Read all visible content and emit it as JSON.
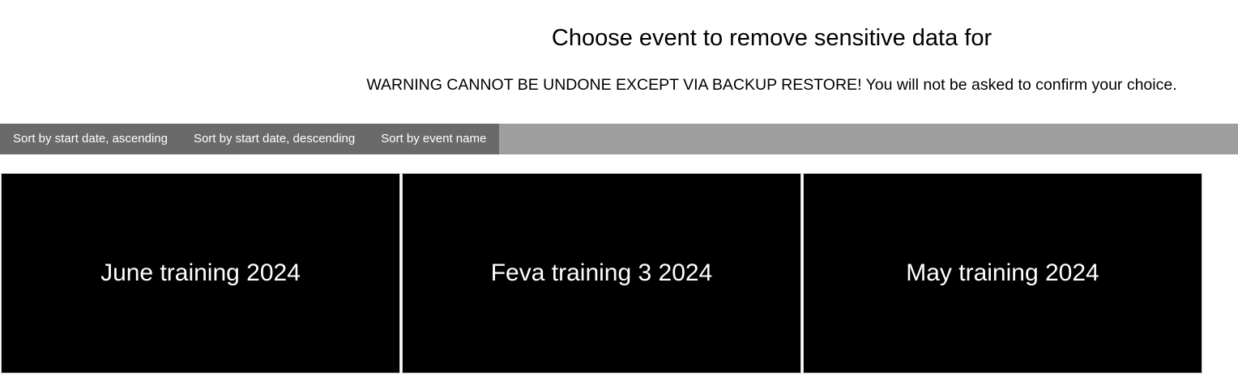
{
  "header": {
    "title": "Choose event to remove sensitive data for",
    "warning": "WARNING CANNOT BE UNDONE EXCEPT VIA BACKUP RESTORE! You will not be asked to confirm your choice."
  },
  "sort_bar": {
    "buttons": [
      {
        "label": "Sort by start date, ascending"
      },
      {
        "label": "Sort by start date, descending"
      },
      {
        "label": "Sort by event name"
      }
    ]
  },
  "events": [
    {
      "name": "June training 2024"
    },
    {
      "name": "Feva training 3 2024"
    },
    {
      "name": "May training 2024"
    }
  ],
  "colors": {
    "sort_bar_background": "#9e9e9e",
    "sort_button_background": "#6a6a6a",
    "card_background": "#000000",
    "card_text": "#ffffff"
  }
}
